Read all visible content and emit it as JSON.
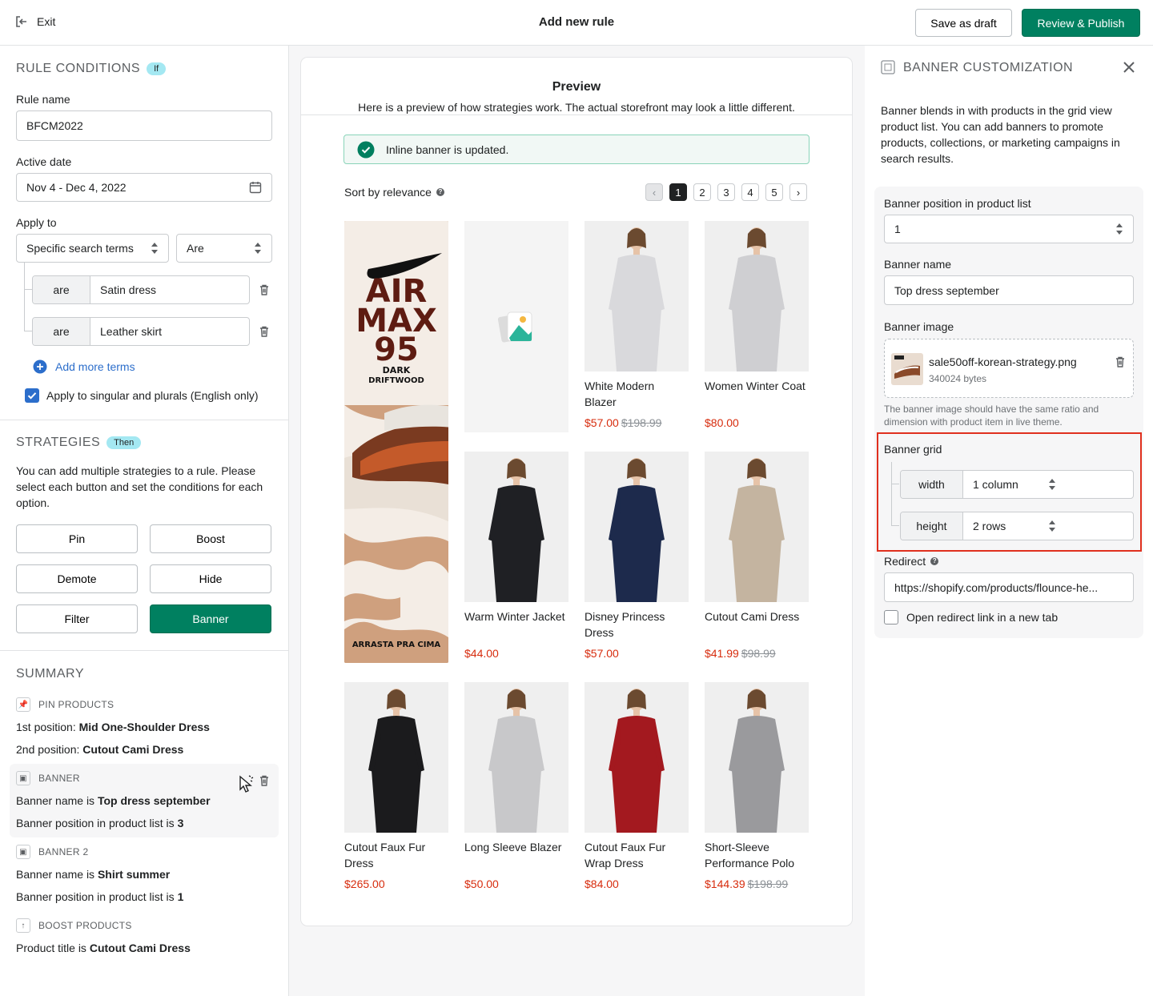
{
  "header": {
    "exit": "Exit",
    "title": "Add new rule",
    "save_draft": "Save as draft",
    "publish": "Review & Publish"
  },
  "conditions": {
    "title": "RULE CONDITIONS",
    "badge": "If",
    "rule_name_label": "Rule name",
    "rule_name": "BFCM2022",
    "active_date_label": "Active date",
    "active_date": "Nov 4 - Dec 4, 2022",
    "apply_to_label": "Apply to",
    "apply_to": "Specific search terms",
    "operator": "Are",
    "terms": [
      {
        "prefix": "are",
        "value": "Satin dress"
      },
      {
        "prefix": "are",
        "value": "Leather skirt"
      }
    ],
    "add_terms": "Add more terms",
    "singular_plural": "Apply to singular and plurals (English only)"
  },
  "strategies": {
    "title": "STRATEGIES",
    "badge": "Then",
    "description": "You can add multiple strategies to a rule. Please select each button and set the conditions for each option.",
    "buttons": [
      "Pin",
      "Boost",
      "Demote",
      "Hide",
      "Filter",
      "Banner"
    ]
  },
  "summary": {
    "title": "SUMMARY",
    "pin": {
      "head": "PIN PRODUCTS",
      "l1_pre": "1st position: ",
      "l1_val": "Mid One-Shoulder Dress",
      "l2_pre": "2nd position: ",
      "l2_val": "Cutout Cami Dress"
    },
    "banner": {
      "head": "BANNER",
      "l1_pre": "Banner name is ",
      "l1_val": "Top dress september",
      "l2_pre": "Banner position in product list is ",
      "l2_val": "3"
    },
    "banner2": {
      "head": "BANNER 2",
      "l1_pre": "Banner name is ",
      "l1_val": "Shirt summer",
      "l2_pre": "Banner position in product list is ",
      "l2_val": "1"
    },
    "boost": {
      "head": "BOOST PRODUCTS",
      "l1_pre": "Product title is ",
      "l1_val": "Cutout Cami Dress"
    }
  },
  "preview": {
    "title": "Preview",
    "subtitle": "Here is a preview of how strategies work. The actual storefront may look a little different.",
    "toast": "Inline banner is updated.",
    "sort": "Sort by relevance",
    "pages": [
      "1",
      "2",
      "3",
      "4",
      "5"
    ],
    "banner_text": {
      "l1": "AIR",
      "l2": "MAX",
      "l3": "95",
      "l4": "DARK",
      "l5": "DRIFTWOOD",
      "l6": "ARRASTA PRA CIMA"
    },
    "products": [
      {
        "name": "White Modern Blazer",
        "price": "$57.00",
        "old": "$198.99",
        "color": "#d9d9dc"
      },
      {
        "name": "Women Winter Coat",
        "price": "$80.00",
        "old": "",
        "color": "#cfcfd2"
      },
      {
        "name": "Warm Winter Jacket",
        "price": "$44.00",
        "old": "",
        "color": "#1f2024"
      },
      {
        "name": "Disney Princess Dress",
        "price": "$57.00",
        "old": "",
        "color": "#1d2a4c"
      },
      {
        "name": "Cutout Cami Dress",
        "price": "$41.99",
        "old": "$98.99",
        "color": "#c4b4a0"
      },
      {
        "name": "Cutout Faux Fur Dress",
        "price": "$265.00",
        "old": "",
        "color": "#1b1b1d"
      },
      {
        "name": "Long Sleeve Blazer",
        "price": "$50.00",
        "old": "",
        "color": "#c8c8ca"
      },
      {
        "name": "Cutout Faux Fur Wrap Dress",
        "price": "$84.00",
        "old": "",
        "color": "#a3191f"
      },
      {
        "name": "Short-Sleeve Performance Polo",
        "price": "$144.39",
        "old": "$198.99",
        "color": "#9a9a9d"
      }
    ]
  },
  "customization": {
    "title": "BANNER CUSTOMIZATION",
    "description": "Banner blends in with products in the grid view product list. You can add banners to promote products, collections, or marketing campaigns in search results.",
    "position_label": "Banner position in product list",
    "position": "1",
    "name_label": "Banner name",
    "name": "Top dress september",
    "image_label": "Banner image",
    "file_name": "sale50off-korean-strategy.png",
    "file_size": "340024 bytes",
    "image_hint": "The banner image should have the same ratio and dimension with product item in live theme.",
    "grid_label": "Banner grid",
    "width_label": "width",
    "width": "1 column",
    "height_label": "height",
    "height": "2 rows",
    "redirect_label": "Redirect",
    "redirect": "https://shopify.com/products/flounce-he...",
    "new_tab": "Open redirect link in a new tab"
  },
  "colors": {
    "primary": "#008060",
    "price": "#d72c0d",
    "highlight": "#e0301e",
    "link": "#2c6ecb"
  }
}
